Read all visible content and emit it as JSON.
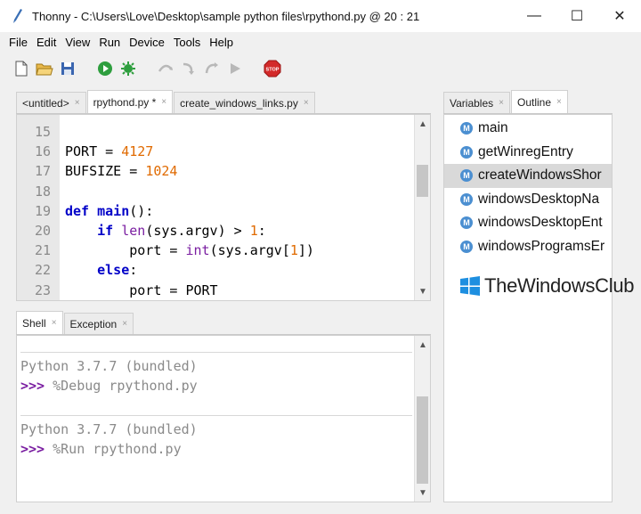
{
  "window": {
    "app_name": "Thonny",
    "title": "Thonny  -  C:\\Users\\Love\\Desktop\\sample python files\\rpythond.py  @  20 : 21",
    "minimize": "—",
    "maximize": "☐",
    "close": "✕"
  },
  "menu": [
    "File",
    "Edit",
    "View",
    "Run",
    "Device",
    "Tools",
    "Help"
  ],
  "toolbar": {
    "icons": [
      "new-file-icon",
      "open-file-icon",
      "save-icon",
      "run-icon",
      "debug-icon",
      "step-over-icon",
      "step-into-icon",
      "step-out-icon",
      "resume-icon",
      "stop-icon"
    ],
    "stop_label": "STOP",
    "colors": {
      "run": "#2e9e3e",
      "debug": "#2e9e3e",
      "stop": "#d32a2a",
      "disabled": "#b8b8b8"
    }
  },
  "editor": {
    "tabs": [
      {
        "label": "<untitled>",
        "close": "×",
        "active": false
      },
      {
        "label": "rpythond.py *",
        "close": "×",
        "active": true
      },
      {
        "label": "create_windows_links.py",
        "close": "×",
        "active": false
      }
    ],
    "line_numbers": [
      "15",
      "16",
      "17",
      "18",
      "19",
      "20",
      "21",
      "22",
      "23"
    ],
    "lines": {
      "l15": "",
      "l16_a": "PORT = ",
      "l16_num": "4127",
      "l17_a": "BUFSIZE = ",
      "l17_num": "1024",
      "l18": "",
      "l19_kw": "def",
      "l19_name": " main",
      "l19_rest": "():",
      "l20_indent": "    ",
      "l20_kw": "if",
      "l20_sp": " ",
      "l20_bi": "len",
      "l20_rest": "(sys.argv) > ",
      "l20_num": "1",
      "l20_end": ":",
      "l21_a": "        port = ",
      "l21_bi": "int",
      "l21_rest": "(sys.argv[",
      "l21_num": "1",
      "l21_end": "])",
      "l22_indent": "    ",
      "l22_kw": "else",
      "l22_end": ":",
      "l23": "        port = PORT"
    }
  },
  "shell": {
    "tabs": [
      {
        "label": "Shell",
        "close": "×",
        "active": true
      },
      {
        "label": "Exception",
        "close": "×",
        "active": false
      }
    ],
    "blocks": [
      {
        "banner": "Python 3.7.7 (bundled)",
        "prompt": ">>>",
        "command": " %Debug rpythond.py"
      },
      {
        "banner": "Python 3.7.7 (bundled)",
        "prompt": ">>>",
        "command": " %Run rpythond.py"
      }
    ]
  },
  "right_panel": {
    "tabs": [
      {
        "label": "Variables",
        "close": "×",
        "active": false
      },
      {
        "label": "Outline",
        "close": "×",
        "active": true
      }
    ],
    "icon_letter": "M",
    "items": [
      {
        "label": "main",
        "selected": false
      },
      {
        "label": "getWinregEntry",
        "selected": false
      },
      {
        "label": "createWindowsShor",
        "selected": true
      },
      {
        "label": "windowsDesktopNa",
        "selected": false
      },
      {
        "label": "windowsDesktopEnt",
        "selected": false
      },
      {
        "label": "windowsProgramsEr",
        "selected": false
      }
    ]
  },
  "watermark": {
    "text": "TheWindowsClub",
    "color": "#1e8fe0"
  }
}
